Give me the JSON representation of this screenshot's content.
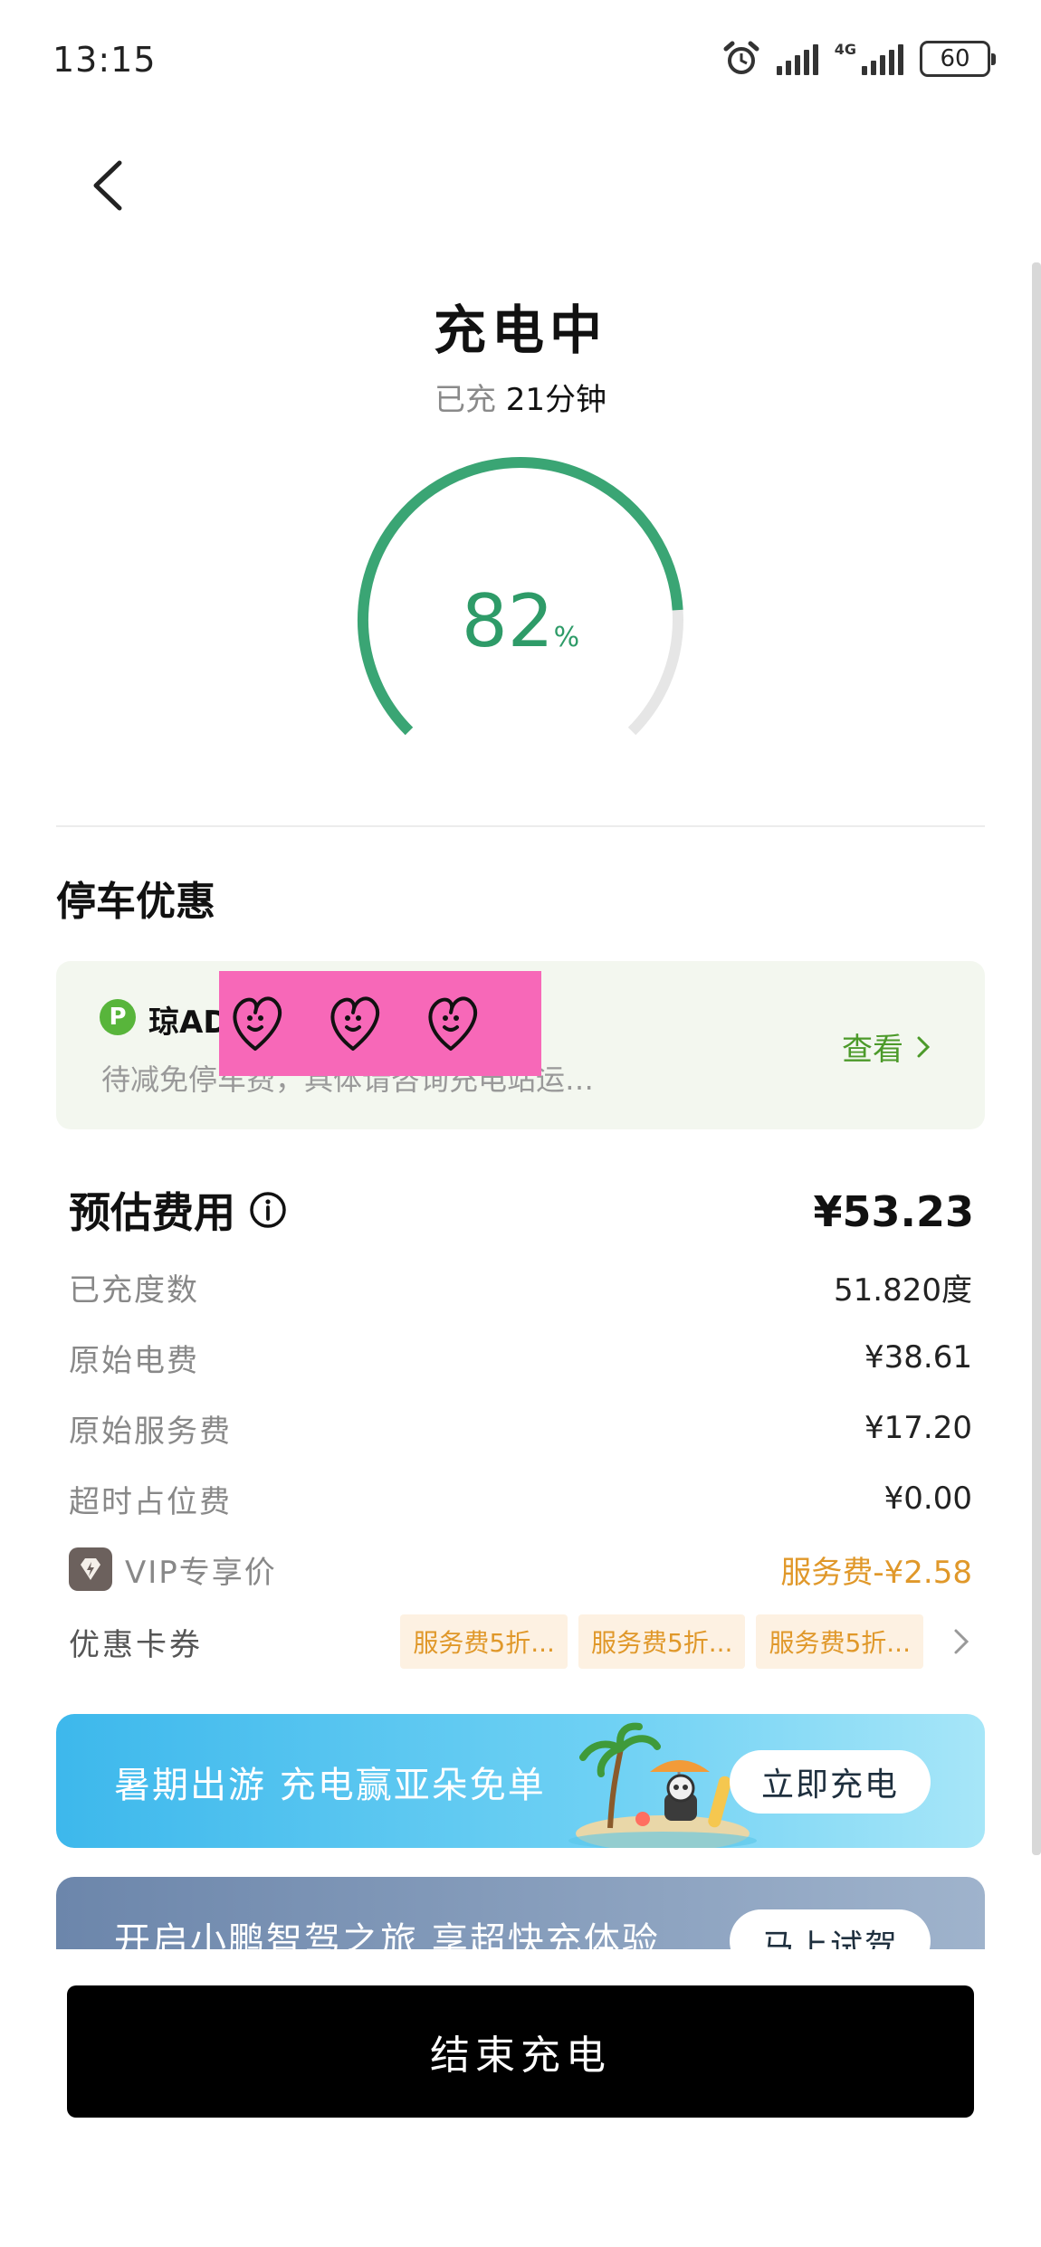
{
  "status_bar": {
    "time": "13:15",
    "network": "4G",
    "battery": "60"
  },
  "header": {
    "title": "充电中",
    "elapsed_prefix": "已充",
    "elapsed_value": "21分钟"
  },
  "gauge": {
    "value": "82",
    "unit": "%",
    "fraction": 0.82,
    "color": "#3aa574",
    "track_color": "#e6e6e6"
  },
  "parking": {
    "section_title": "停车优惠",
    "badge": "P",
    "name": "琼AD",
    "description": "待减免停车费，具体请咨询充电站运…",
    "view_label": "查看"
  },
  "fees": {
    "title": "预估费用",
    "total": "¥53.23",
    "rows": [
      {
        "label": "已充度数",
        "value": "51.820度"
      },
      {
        "label": "原始电费",
        "value": "¥38.61"
      },
      {
        "label": "原始服务费",
        "value": "¥17.20"
      },
      {
        "label": "超时占位费",
        "value": "¥0.00"
      }
    ],
    "vip_label": "VIP专享价",
    "vip_value": "服务费-¥2.58",
    "coupon_label": "优惠卡券",
    "coupons": [
      "服务费5折...",
      "服务费5折...",
      "服务费5折..."
    ]
  },
  "banners": {
    "first_text": "暑期出游 充电赢亚朵免单",
    "first_button": "立即充电",
    "second_text": "开启小鹏智驾之旅 享超快充体验",
    "second_button": "马上试驾"
  },
  "actions": {
    "end_charging": "结束充电"
  }
}
